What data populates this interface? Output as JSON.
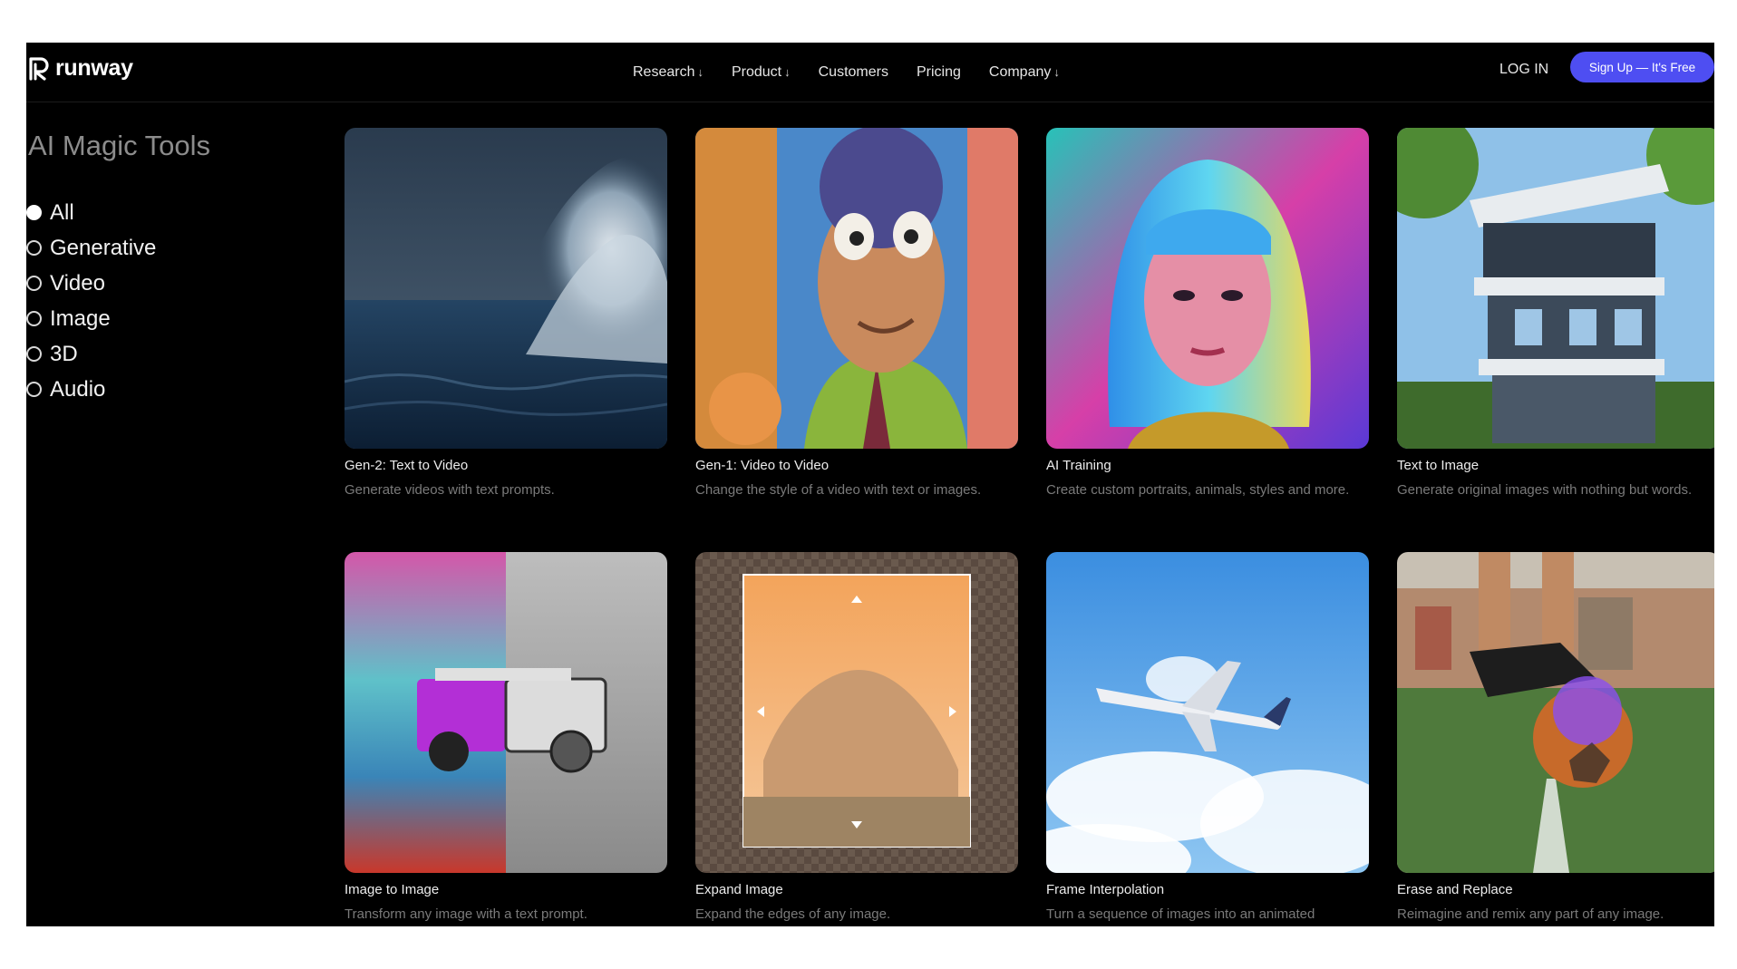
{
  "brand": {
    "name": "runway"
  },
  "nav": {
    "items": [
      {
        "label": "Research",
        "dropdown": true
      },
      {
        "label": "Product",
        "dropdown": true
      },
      {
        "label": "Customers",
        "dropdown": false
      },
      {
        "label": "Pricing",
        "dropdown": false
      },
      {
        "label": "Company",
        "dropdown": true
      }
    ],
    "login": "LOG IN",
    "signup": "Sign Up — It's Free",
    "dropdown_glyph": "↓"
  },
  "sidebar": {
    "title": "AI Magic Tools",
    "filters": [
      {
        "label": "All",
        "selected": true
      },
      {
        "label": "Generative",
        "selected": false
      },
      {
        "label": "Video",
        "selected": false
      },
      {
        "label": "Image",
        "selected": false
      },
      {
        "label": "3D",
        "selected": false
      },
      {
        "label": "Audio",
        "selected": false
      }
    ]
  },
  "tools": [
    {
      "title": "Gen-2: Text to Video",
      "description": "Generate videos with text prompts.",
      "image": "ocean-wave"
    },
    {
      "title": "Gen-1: Video to Video",
      "description": "Change the style of a video with text or images.",
      "image": "clay-character"
    },
    {
      "title": "AI Training",
      "description": "Create custom portraits, animals, styles and more.",
      "image": "neon-portrait"
    },
    {
      "title": "Text to Image",
      "description": "Generate original images with nothing but words.",
      "image": "modern-house"
    },
    {
      "title": "Image to Image",
      "description": "Transform any image with a text prompt.",
      "image": "painted-jeep"
    },
    {
      "title": "Expand Image",
      "description": "Expand the edges of any image.",
      "image": "desert-rock"
    },
    {
      "title": "Frame Interpolation",
      "description": "Turn a sequence of images into an animated",
      "image": "airplane-sky"
    },
    {
      "title": "Erase and Replace",
      "description": "Reimagine and remix any part of any image.",
      "image": "soccer-ball"
    }
  ],
  "colors": {
    "accent": "#4e4ef2",
    "background": "#000000",
    "muted_text": "#7a7a7a"
  }
}
